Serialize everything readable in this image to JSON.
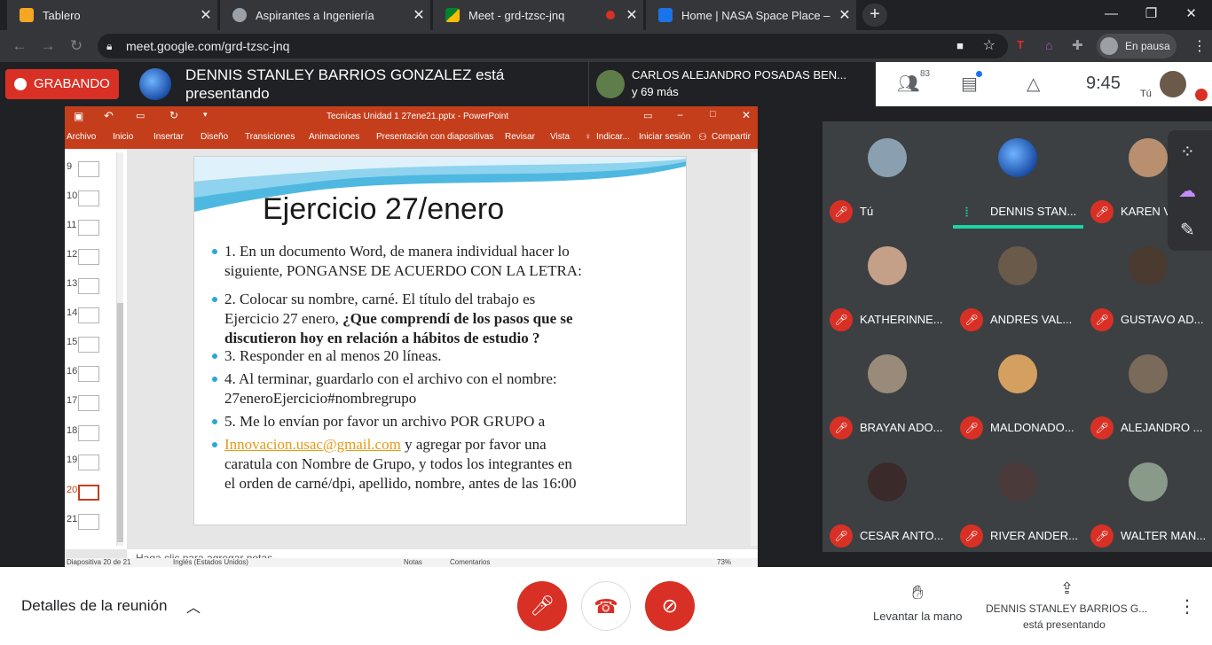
{
  "browser": {
    "tabs": [
      {
        "label": "Tablero",
        "favicon_color": "#f5a623"
      },
      {
        "label": "Aspirantes a Ingeniería",
        "favicon_color": "#9aa0a6"
      },
      {
        "label": "Meet - grd-tzsc-jnq",
        "favicon_color": "#00832d"
      },
      {
        "label": "Home | NASA Space Place – NAS",
        "favicon_color": "#1a73e8"
      }
    ],
    "new_tab": "+",
    "url": "meet.google.com/grd-tzsc-jnq",
    "profile_label": "En pausa",
    "window_controls": {
      "minimize": "—",
      "restore": "❐",
      "close": "✕"
    }
  },
  "meet": {
    "recording_label": "GRABANDO",
    "presenter_text": "DENNIS STANLEY BARRIOS GONZALEZ está presentando",
    "others_name": "CARLOS ALEJANDRO POSADAS BEN...",
    "others_more": "y 69 más",
    "participants_count": "83",
    "clock": "9:45",
    "self_label": "Tú"
  },
  "powerpoint": {
    "file_title": "Tecnicas Unidad 1 27ene21.pptx - PowerPoint",
    "menu": [
      "Archivo",
      "Inicio",
      "Insertar",
      "Diseño",
      "Transiciones",
      "Animaciones",
      "Presentación con diapositivas",
      "Revisar",
      "Vista",
      "Indicar...",
      "Iniciar sesión",
      "Compartir"
    ],
    "slide_numbers": [
      "9",
      "10",
      "11",
      "12",
      "13",
      "14",
      "15",
      "16",
      "17",
      "18",
      "19",
      "20",
      "21"
    ],
    "current_slide": "20",
    "notes_placeholder": "Haga clic para agregar notas",
    "status": {
      "slide_info": "Diapositiva 20 de 21",
      "language": "Inglés (Estados Unidos)",
      "notes": "Notas",
      "comments": "Comentarios",
      "zoom": "73%"
    },
    "slide": {
      "title": "Ejercicio 27/enero",
      "bullets": [
        {
          "lines": [
            "1. En un documento Word, de manera individual hacer lo",
            "siguiente, PONGANSE DE ACUERDO CON LA LETRA:"
          ]
        },
        {
          "lines": [
            "2. Colocar su nombre, carné. El título del trabajo es",
            "Ejercicio 27 enero, "
          ],
          "bold_inline": "¿Que comprendí de los pasos que se",
          "bold_line": "discutieron hoy en relación a hábitos de estudio ?"
        },
        {
          "lines": [
            "3. Responder en al menos 20 líneas."
          ]
        },
        {
          "lines": [
            "4. Al terminar, guardarlo con el archivo con el nombre:",
            "27eneroEjercicio#nombregrupo"
          ]
        },
        {
          "lines": [
            "5. Me lo envían por favor un archivo POR GRUPO a"
          ]
        },
        {
          "link": "Innovacion.usac@gmail.com",
          "after_link": " y agregar por favor una",
          "lines": [
            "caratula con Nombre de Grupo, y todos los integrantes en",
            "el orden de carné/dpi, apellido, nombre, antes de las 16:00"
          ]
        }
      ]
    }
  },
  "participants": [
    {
      "name": "Tú",
      "muted": true
    },
    {
      "name": "DENNIS STAN...",
      "muted": false,
      "speaking": true
    },
    {
      "name": "KAREN V...",
      "muted": true
    },
    {
      "name": "KATHERINNE...",
      "muted": true
    },
    {
      "name": "ANDRES VAL...",
      "muted": true
    },
    {
      "name": "GUSTAVO AD...",
      "muted": true
    },
    {
      "name": "BRAYAN ADO...",
      "muted": true
    },
    {
      "name": "MALDONADO...",
      "muted": true
    },
    {
      "name": "ALEJANDRO ...",
      "muted": true
    },
    {
      "name": "CESAR ANTO...",
      "muted": true
    },
    {
      "name": "RIVER ANDER...",
      "muted": true
    },
    {
      "name": "WALTER MAN...",
      "muted": true
    }
  ],
  "bottom": {
    "details_label": "Detalles de la reunión",
    "raise_hand_label": "Levantar la mano",
    "presenting_name": "DENNIS STANLEY BARRIOS G...",
    "presenting_sub": "está presentando"
  }
}
